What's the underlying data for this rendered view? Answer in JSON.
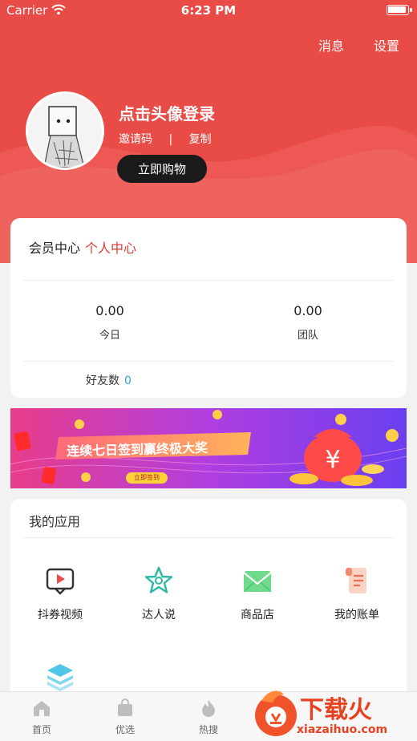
{
  "status_bar": {
    "carrier": "Carrier",
    "time": "6:23 PM"
  },
  "header": {
    "messages": "消息",
    "settings": "设置",
    "login_prompt": "点击头像登录",
    "invite_code": "邀请码",
    "separator": "|",
    "copy": "复制",
    "shop_now": "立即购物",
    "background_color": "#e94b47"
  },
  "member": {
    "tab_member": "会员中心",
    "tab_personal": "个人中心",
    "today_value": "0.00",
    "today_label": "今日",
    "team_value": "0.00",
    "team_label": "团队",
    "friends_label": "好友数",
    "friends_value": "0"
  },
  "banner": {
    "headline": "连续七日签到赢终极大奖",
    "cta": "立即签到"
  },
  "apps": {
    "title": "我的应用",
    "items": [
      {
        "label": "抖券视频",
        "icon": "video-icon"
      },
      {
        "label": "达人说",
        "icon": "star-icon"
      },
      {
        "label": "商品店",
        "icon": "mail-store-icon"
      },
      {
        "label": "我的账单",
        "icon": "bill-icon"
      },
      {
        "label": "",
        "icon": "layers-icon"
      }
    ]
  },
  "tabbar": {
    "items": [
      {
        "label": "首页",
        "icon": "home-icon"
      },
      {
        "label": "优选",
        "icon": "bag-icon"
      },
      {
        "label": "热搜",
        "icon": "flame-icon"
      }
    ]
  },
  "watermark": {
    "brand": "下载火",
    "domain": "xiazaihuo.com"
  }
}
